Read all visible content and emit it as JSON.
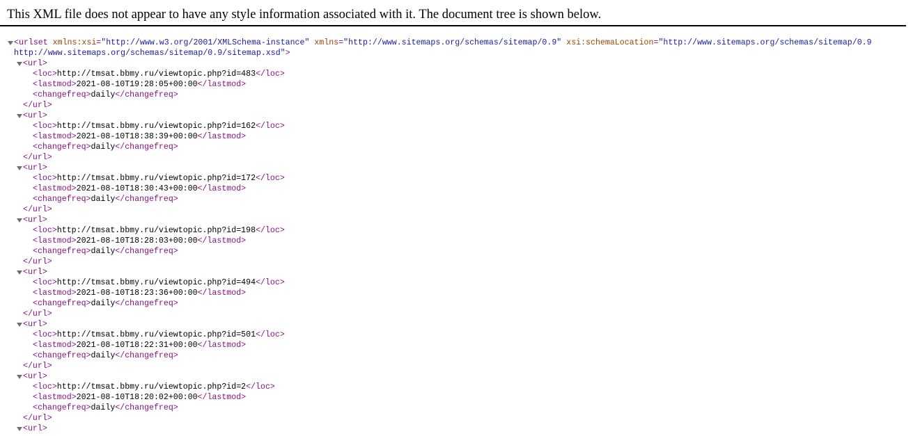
{
  "info_message": "This XML file does not appear to have any style information associated with it. The document tree is shown below.",
  "urlset": {
    "open_tag_start": "<urlset",
    "attrs": [
      {
        "name": "xmlns:xsi",
        "value": "\"http://www.w3.org/2001/XMLSchema-instance\""
      },
      {
        "name": "xmlns",
        "value": "\"http://www.sitemaps.org/schemas/sitemap/0.9\""
      },
      {
        "name": "xsi:schemaLocation",
        "value": "\"http://www.sitemaps.org/schemas/sitemap/0.9"
      }
    ],
    "schema_continuation": "http://www.sitemaps.org/schemas/sitemap/0.9/sitemap.xsd\"",
    "open_tag_end": ">"
  },
  "urls": [
    {
      "loc": "http://tmsat.bbmy.ru/viewtopic.php?id=483",
      "lastmod": "2021-08-10T19:28:05+00:00",
      "changefreq": "daily"
    },
    {
      "loc": "http://tmsat.bbmy.ru/viewtopic.php?id=162",
      "lastmod": "2021-08-10T18:38:39+00:00",
      "changefreq": "daily"
    },
    {
      "loc": "http://tmsat.bbmy.ru/viewtopic.php?id=172",
      "lastmod": "2021-08-10T18:30:43+00:00",
      "changefreq": "daily"
    },
    {
      "loc": "http://tmsat.bbmy.ru/viewtopic.php?id=198",
      "lastmod": "2021-08-10T18:28:03+00:00",
      "changefreq": "daily"
    },
    {
      "loc": "http://tmsat.bbmy.ru/viewtopic.php?id=494",
      "lastmod": "2021-08-10T18:23:36+00:00",
      "changefreq": "daily"
    },
    {
      "loc": "http://tmsat.bbmy.ru/viewtopic.php?id=501",
      "lastmod": "2021-08-10T18:22:31+00:00",
      "changefreq": "daily"
    },
    {
      "loc": "http://tmsat.bbmy.ru/viewtopic.php?id=2",
      "lastmod": "2021-08-10T18:20:02+00:00",
      "changefreq": "daily"
    }
  ],
  "partial_url_open_tag": "<url>",
  "tags": {
    "url_open": "<url>",
    "url_close": "</url>",
    "loc_open": "<loc>",
    "loc_close": "</loc>",
    "lastmod_open": "<lastmod>",
    "lastmod_close": "</lastmod>",
    "changefreq_open": "<changefreq>",
    "changefreq_close": "</changefreq>"
  },
  "colors": {
    "tag": "#881280",
    "attr_name": "#994500",
    "attr_value": "#1a1aa6",
    "text": "#000000",
    "toggle": "#6e6e6e"
  },
  "icons": {
    "collapse_toggle": "triangle-down-icon"
  }
}
